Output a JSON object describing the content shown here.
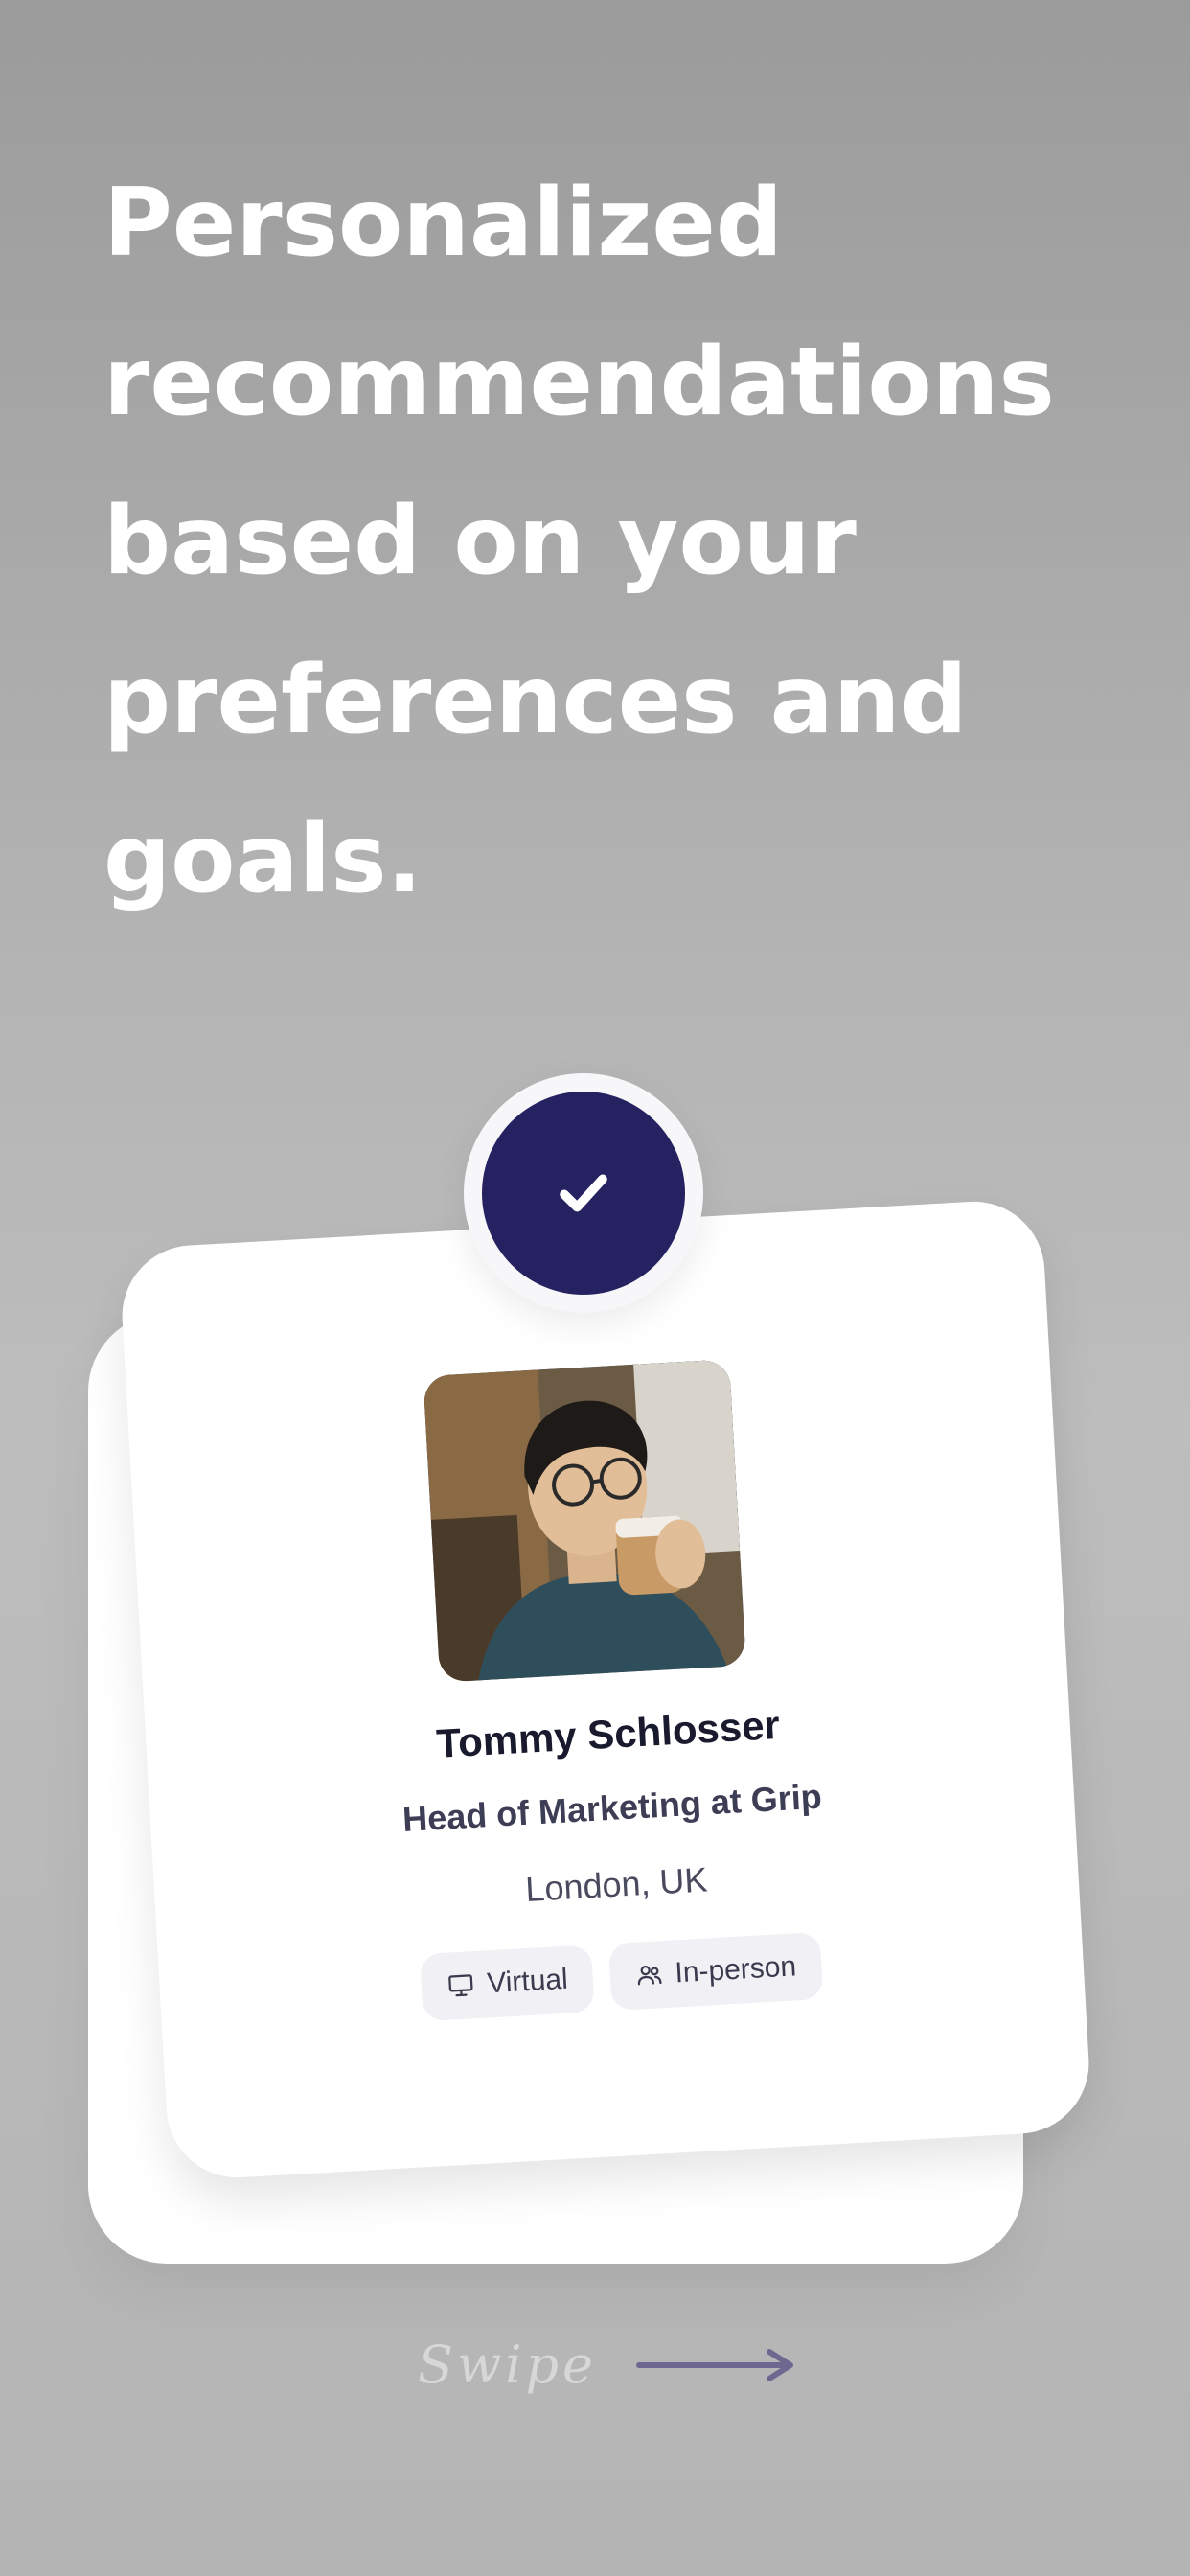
{
  "headline": {
    "lines": [
      "Personalized",
      "recommendations",
      "based on your",
      "preferences and",
      "goals."
    ]
  },
  "profile": {
    "name": "Tommy Schlosser",
    "title": "Head of Marketing at Grip",
    "location": "London, UK",
    "tags": [
      {
        "icon": "monitor-icon",
        "label": "Virtual"
      },
      {
        "icon": "people-icon",
        "label": "In-person"
      }
    ]
  },
  "badge": {
    "icon": "checkmark-icon",
    "color": "#262262"
  },
  "swipe": {
    "label": "Swipe",
    "icon": "arrow-right-icon",
    "arrow_color": "#6e6890"
  },
  "colors": {
    "headline": "#ffffff",
    "card": "#ffffff",
    "tag_bg": "#f0f0f5",
    "name_text": "#1a1a2e"
  }
}
